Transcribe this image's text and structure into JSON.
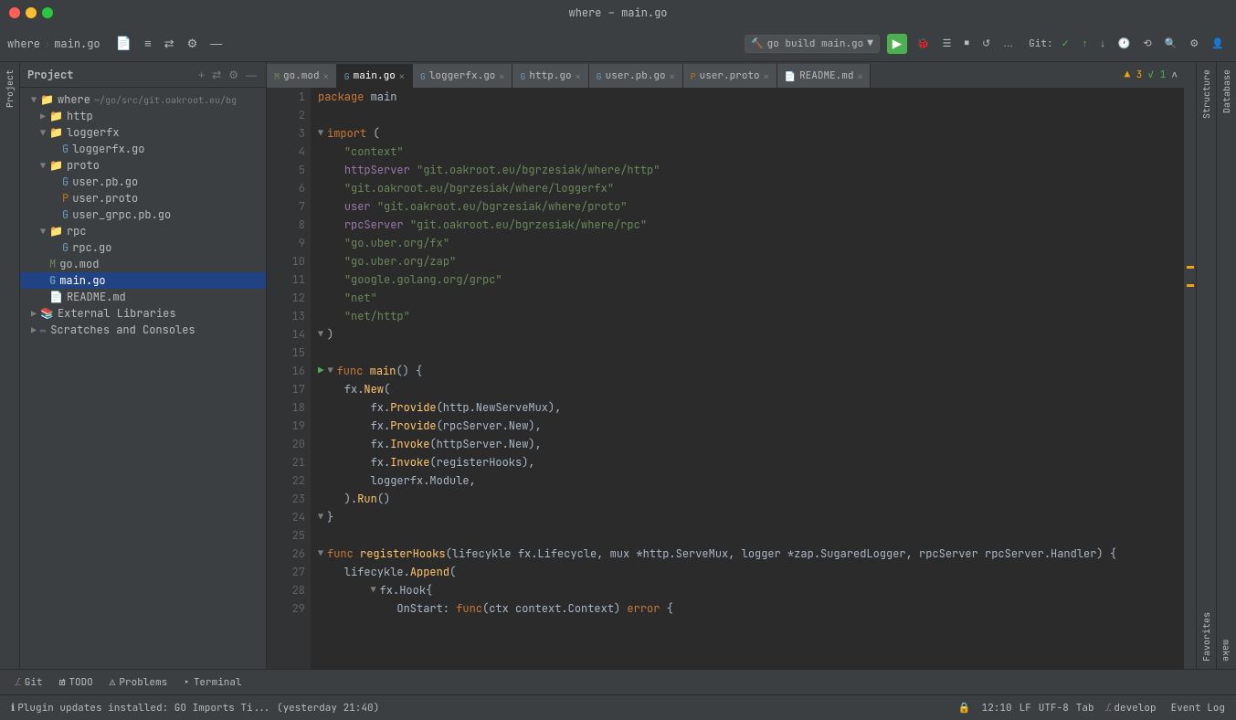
{
  "titleBar": {
    "title": "where – main.go",
    "buttons": [
      "close",
      "minimize",
      "maximize"
    ]
  },
  "breadcrumb": {
    "project": "where",
    "file": "main.go"
  },
  "toolbar": {
    "buildLabel": "go build main.go",
    "gitLabel": "Git:",
    "profileLabel": "",
    "searchLabel": ""
  },
  "tabs": [
    {
      "id": "go-mod",
      "label": "go.mod",
      "type": "mod",
      "active": false
    },
    {
      "id": "main-go",
      "label": "main.go",
      "type": "go",
      "active": true
    },
    {
      "id": "loggerfx-go",
      "label": "loggerfx.go",
      "type": "go",
      "active": false
    },
    {
      "id": "http-go",
      "label": "http.go",
      "type": "go",
      "active": false
    },
    {
      "id": "user-pb-go",
      "label": "user.pb.go",
      "type": "go",
      "active": false
    },
    {
      "id": "user-proto",
      "label": "user.proto",
      "type": "proto",
      "active": false
    },
    {
      "id": "readme-md",
      "label": "README.md",
      "type": "md",
      "active": false
    }
  ],
  "projectTree": {
    "title": "Project",
    "items": [
      {
        "id": "where-root",
        "label": "where",
        "path": "~/go/src/git.oakroot.eu/bg",
        "type": "folder",
        "expanded": true,
        "indent": 0
      },
      {
        "id": "http-folder",
        "label": "http",
        "type": "folder",
        "expanded": false,
        "indent": 1
      },
      {
        "id": "loggerfx-folder",
        "label": "loggerfx",
        "type": "folder",
        "expanded": true,
        "indent": 1
      },
      {
        "id": "loggerfx-go-file",
        "label": "loggerfx.go",
        "type": "go",
        "indent": 2
      },
      {
        "id": "proto-folder",
        "label": "proto",
        "type": "folder",
        "expanded": true,
        "indent": 1
      },
      {
        "id": "user-pb-go-file",
        "label": "user.pb.go",
        "type": "go",
        "indent": 2
      },
      {
        "id": "user-proto-file",
        "label": "user.proto",
        "type": "proto",
        "indent": 2
      },
      {
        "id": "user-grpc-pb-go-file",
        "label": "user_grpc.pb.go",
        "type": "go",
        "indent": 2
      },
      {
        "id": "rpc-folder",
        "label": "rpc",
        "type": "folder",
        "expanded": true,
        "indent": 1
      },
      {
        "id": "rpc-go-file",
        "label": "rpc.go",
        "type": "go",
        "indent": 2
      },
      {
        "id": "go-mod-file",
        "label": "go.mod",
        "type": "mod",
        "indent": 1
      },
      {
        "id": "main-go-file",
        "label": "main.go",
        "type": "go",
        "indent": 1,
        "selected": true
      },
      {
        "id": "readme-md-file",
        "label": "README.md",
        "type": "md",
        "indent": 1
      },
      {
        "id": "external-libs",
        "label": "External Libraries",
        "type": "extlibs",
        "indent": 0
      },
      {
        "id": "scratches",
        "label": "Scratches and Consoles",
        "type": "scratches",
        "indent": 0
      }
    ]
  },
  "codeLines": [
    {
      "num": 1,
      "content": "package main",
      "tokens": [
        {
          "t": "kw",
          "v": "package"
        },
        {
          "t": "plain",
          "v": " main"
        }
      ]
    },
    {
      "num": 2,
      "content": "",
      "tokens": []
    },
    {
      "num": 3,
      "content": "import (",
      "tokens": [
        {
          "t": "kw",
          "v": "import"
        },
        {
          "t": "plain",
          "v": " ("
        }
      ],
      "foldable": true
    },
    {
      "num": 4,
      "content": "    \"context\"",
      "tokens": [
        {
          "t": "plain",
          "v": "    "
        },
        {
          "t": "str",
          "v": "\"context\""
        }
      ]
    },
    {
      "num": 5,
      "content": "    httpServer \"git.oakroot.eu/bgrzesiak/where/http\"",
      "tokens": [
        {
          "t": "plain",
          "v": "    "
        },
        {
          "t": "pkg-alias",
          "v": "httpServer"
        },
        {
          "t": "plain",
          "v": " "
        },
        {
          "t": "str",
          "v": "\"git.oakroot.eu/bgrzesiak/where/http\""
        }
      ]
    },
    {
      "num": 6,
      "content": "    \"git.oakroot.eu/bgrzesiak/where/loggerfx\"",
      "tokens": [
        {
          "t": "plain",
          "v": "    "
        },
        {
          "t": "str",
          "v": "\"git.oakroot.eu/bgrzesiak/where/loggerfx\""
        }
      ]
    },
    {
      "num": 7,
      "content": "    user \"git.oakroot.eu/bgrzesiak/where/proto\"",
      "tokens": [
        {
          "t": "plain",
          "v": "    "
        },
        {
          "t": "pkg-alias",
          "v": "user"
        },
        {
          "t": "plain",
          "v": " "
        },
        {
          "t": "str",
          "v": "\"git.oakroot.eu/bgrzesiak/where/proto\""
        }
      ]
    },
    {
      "num": 8,
      "content": "    rpcServer \"git.oakroot.eu/bgrzesiak/where/rpc\"",
      "tokens": [
        {
          "t": "plain",
          "v": "    "
        },
        {
          "t": "pkg-alias",
          "v": "rpcServer"
        },
        {
          "t": "plain",
          "v": " "
        },
        {
          "t": "str",
          "v": "\"git.oakroot.eu/bgrzesiak/where/rpc\""
        }
      ]
    },
    {
      "num": 9,
      "content": "    \"go.uber.org/fx\"",
      "tokens": [
        {
          "t": "plain",
          "v": "    "
        },
        {
          "t": "str",
          "v": "\"go.uber.org/fx\""
        }
      ]
    },
    {
      "num": 10,
      "content": "    \"go.uber.org/zap\"",
      "tokens": [
        {
          "t": "plain",
          "v": "    "
        },
        {
          "t": "str",
          "v": "\"go.uber.org/zap\""
        }
      ]
    },
    {
      "num": 11,
      "content": "    \"google.golang.org/grpc\"",
      "tokens": [
        {
          "t": "plain",
          "v": "    "
        },
        {
          "t": "str",
          "v": "\"google.golang.org/grpc\""
        }
      ]
    },
    {
      "num": 12,
      "content": "    \"net\"",
      "tokens": [
        {
          "t": "plain",
          "v": "    "
        },
        {
          "t": "str",
          "v": "\"net\""
        }
      ]
    },
    {
      "num": 13,
      "content": "    \"net/http\"",
      "tokens": [
        {
          "t": "plain",
          "v": "    "
        },
        {
          "t": "str",
          "v": "\"net/http\""
        }
      ]
    },
    {
      "num": 14,
      "content": ")",
      "tokens": [
        {
          "t": "plain",
          "v": ")"
        }
      ]
    },
    {
      "num": 15,
      "content": "",
      "tokens": []
    },
    {
      "num": 16,
      "content": "func main() {",
      "tokens": [
        {
          "t": "kw",
          "v": "func"
        },
        {
          "t": "plain",
          "v": " "
        },
        {
          "t": "fn",
          "v": "main"
        },
        {
          "t": "plain",
          "v": "() {"
        }
      ],
      "runnable": true,
      "foldable": true
    },
    {
      "num": 17,
      "content": "    fx.New(",
      "tokens": [
        {
          "t": "plain",
          "v": "    "
        },
        {
          "t": "pkg",
          "v": "fx"
        },
        {
          "t": "plain",
          "v": "."
        },
        {
          "t": "fn",
          "v": "New"
        },
        {
          "t": "plain",
          "v": "("
        }
      ]
    },
    {
      "num": 18,
      "content": "        fx.Provide(http.NewServeMux),",
      "tokens": [
        {
          "t": "plain",
          "v": "        "
        },
        {
          "t": "pkg",
          "v": "fx"
        },
        {
          "t": "plain",
          "v": "."
        },
        {
          "t": "fn",
          "v": "Provide"
        },
        {
          "t": "plain",
          "v": "(http.NewServeMux),"
        }
      ]
    },
    {
      "num": 19,
      "content": "        fx.Provide(rpcServer.New),",
      "tokens": [
        {
          "t": "plain",
          "v": "        "
        },
        {
          "t": "pkg",
          "v": "fx"
        },
        {
          "t": "plain",
          "v": "."
        },
        {
          "t": "fn",
          "v": "Provide"
        },
        {
          "t": "plain",
          "v": "(rpcServer.New),"
        }
      ]
    },
    {
      "num": 20,
      "content": "        fx.Invoke(httpServer.New),",
      "tokens": [
        {
          "t": "plain",
          "v": "        "
        },
        {
          "t": "pkg",
          "v": "fx"
        },
        {
          "t": "plain",
          "v": "."
        },
        {
          "t": "fn",
          "v": "Invoke"
        },
        {
          "t": "plain",
          "v": "(httpServer.New),"
        }
      ]
    },
    {
      "num": 21,
      "content": "        fx.Invoke(registerHooks),",
      "tokens": [
        {
          "t": "plain",
          "v": "        "
        },
        {
          "t": "pkg",
          "v": "fx"
        },
        {
          "t": "plain",
          "v": "."
        },
        {
          "t": "fn",
          "v": "Invoke"
        },
        {
          "t": "plain",
          "v": "(registerHooks),"
        }
      ]
    },
    {
      "num": 22,
      "content": "        loggerfx.Module,",
      "tokens": [
        {
          "t": "plain",
          "v": "        "
        },
        {
          "t": "pkg",
          "v": "loggerfx"
        },
        {
          "t": "plain",
          "v": ".Module,"
        }
      ]
    },
    {
      "num": 23,
      "content": "    ).Run()",
      "tokens": [
        {
          "t": "plain",
          "v": "    )."
        },
        {
          "t": "fn",
          "v": "Run"
        },
        {
          "t": "plain",
          "v": "()"
        }
      ]
    },
    {
      "num": 24,
      "content": "}",
      "tokens": [
        {
          "t": "plain",
          "v": "}"
        }
      ],
      "foldable": true
    },
    {
      "num": 25,
      "content": "",
      "tokens": []
    },
    {
      "num": 26,
      "content": "func registerHooks(lifecykle fx.Lifecycle, mux *http.ServeMux, logger *zap.SugaredLogger, rpcServer rpcServer.Handler) {",
      "tokens": [
        {
          "t": "kw",
          "v": "func"
        },
        {
          "t": "plain",
          "v": " "
        },
        {
          "t": "fn",
          "v": "registerHooks"
        },
        {
          "t": "plain",
          "v": "(lifecykle "
        },
        {
          "t": "pkg",
          "v": "fx"
        },
        {
          "t": "plain",
          "v": ".Lifecycle, mux *http.ServeMux, logger *zap.SugaredLogger, rpcServer rpcServer.Handler) {"
        }
      ],
      "foldable": true
    },
    {
      "num": 27,
      "content": "    lifecykle.Append(",
      "tokens": [
        {
          "t": "plain",
          "v": "    lifecykle."
        },
        {
          "t": "fn",
          "v": "Append"
        },
        {
          "t": "plain",
          "v": "("
        }
      ]
    },
    {
      "num": 28,
      "content": "        fx.Hook{",
      "tokens": [
        {
          "t": "plain",
          "v": "        "
        },
        {
          "t": "pkg",
          "v": "fx"
        },
        {
          "t": "plain",
          "v": ".Hook{"
        }
      ],
      "foldable": true
    },
    {
      "num": 29,
      "content": "            OnStart: func(ctx context.Context) error {",
      "tokens": [
        {
          "t": "plain",
          "v": "            OnStart: "
        },
        {
          "t": "kw",
          "v": "func"
        },
        {
          "t": "plain",
          "v": "(ctx context.Context) "
        },
        {
          "t": "kw",
          "v": "error"
        },
        {
          "t": "plain",
          "v": " {"
        }
      ]
    }
  ],
  "statusBar": {
    "gitIcon": "⎇",
    "branch": "develop",
    "status": "Plugin updates installed: GO Imports Ti... (yesterday 21:40)",
    "time": "12:10",
    "lineEnding": "LF",
    "encoding": "UTF-8",
    "indent": "Tab",
    "eventLog": "Event Log"
  },
  "bottomTabs": [
    {
      "id": "git",
      "label": "Git",
      "icon": "⎇"
    },
    {
      "id": "todo",
      "label": "TODO",
      "icon": "☑"
    },
    {
      "id": "problems",
      "label": "Problems",
      "icon": "⚠"
    },
    {
      "id": "terminal",
      "label": "Terminal",
      "icon": ">"
    }
  ],
  "warningBadge": "▲ 3",
  "okBadge": "✓ 1",
  "sidePanels": {
    "database": "Database",
    "structure": "Structure",
    "favorites": "Favorites",
    "make": "make"
  }
}
